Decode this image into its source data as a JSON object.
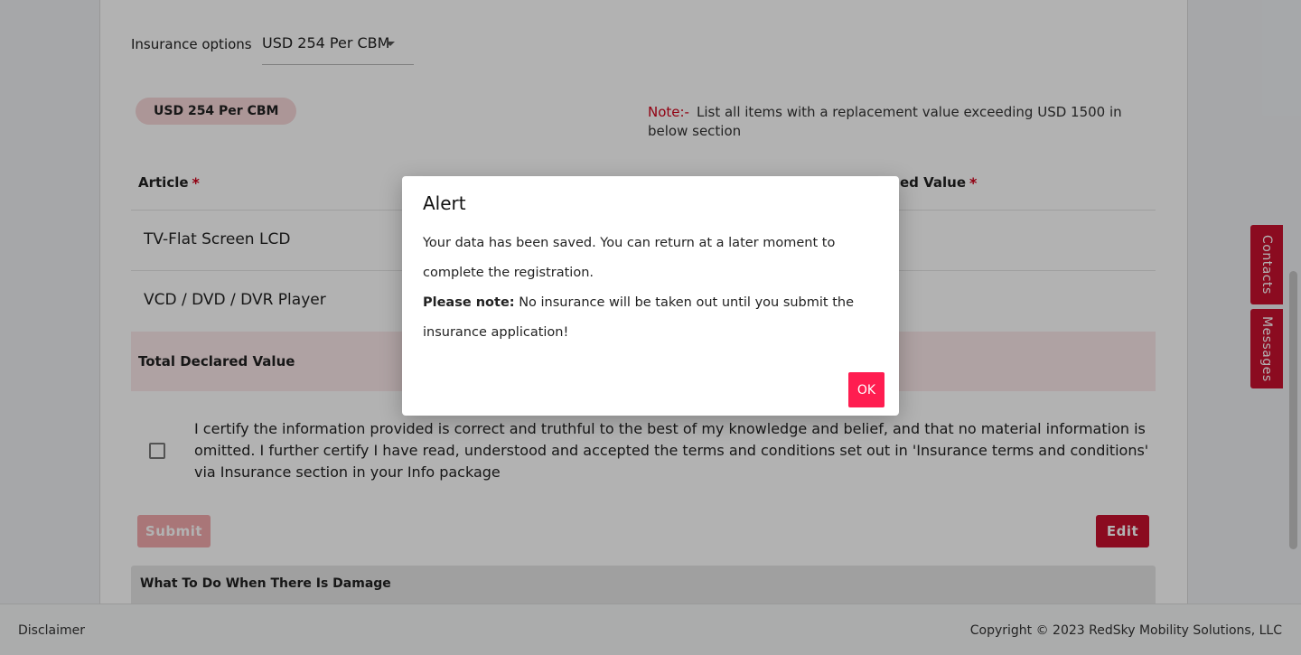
{
  "insurance": {
    "label": "Insurance options",
    "selected": "USD 254 Per CBM"
  },
  "chip": {
    "label": "USD 254 Per CBM"
  },
  "note": {
    "label": "Note:-",
    "text": "List all items with a replacement value exceeding USD 1500 in below section"
  },
  "table": {
    "headers": {
      "article": "Article",
      "declared_value": "ed Value",
      "required_mark": "*"
    },
    "rows": [
      "TV-Flat Screen LCD",
      "VCD / DVD / DVR Player"
    ],
    "total_label": "Total Declared Value"
  },
  "certify": {
    "text": "I certify the information provided is correct and truthful to the best of my knowledge and belief, and that no material information is omitted. I further certify I have read, understood and accepted the terms and conditions set out in 'Insurance terms and conditions' via Insurance section in your Info package"
  },
  "buttons": {
    "submit": "Submit",
    "edit": "Edit"
  },
  "damage": {
    "title": "What To Do When There Is Damage"
  },
  "footer": {
    "disclaimer": "Disclaimer",
    "copyright": "Copyright © 2023 RedSky Mobility Solutions, LLC"
  },
  "side_tabs": {
    "contacts": "Contacts",
    "messages": "Messages"
  },
  "alert": {
    "title": "Alert",
    "message": "Your data has been saved. You can return at a later moment to complete the registration.",
    "note_label": "Please note:",
    "note_text": "No insurance will be taken out until you submit the insurance application!",
    "ok": "OK"
  },
  "colors": {
    "brand_red": "#c8102e",
    "ok_button": "#ff1d50",
    "chip_bg": "#f6d7d9",
    "total_bg": "#fbe9ea",
    "submit_disabled": "#f3a9ad"
  }
}
